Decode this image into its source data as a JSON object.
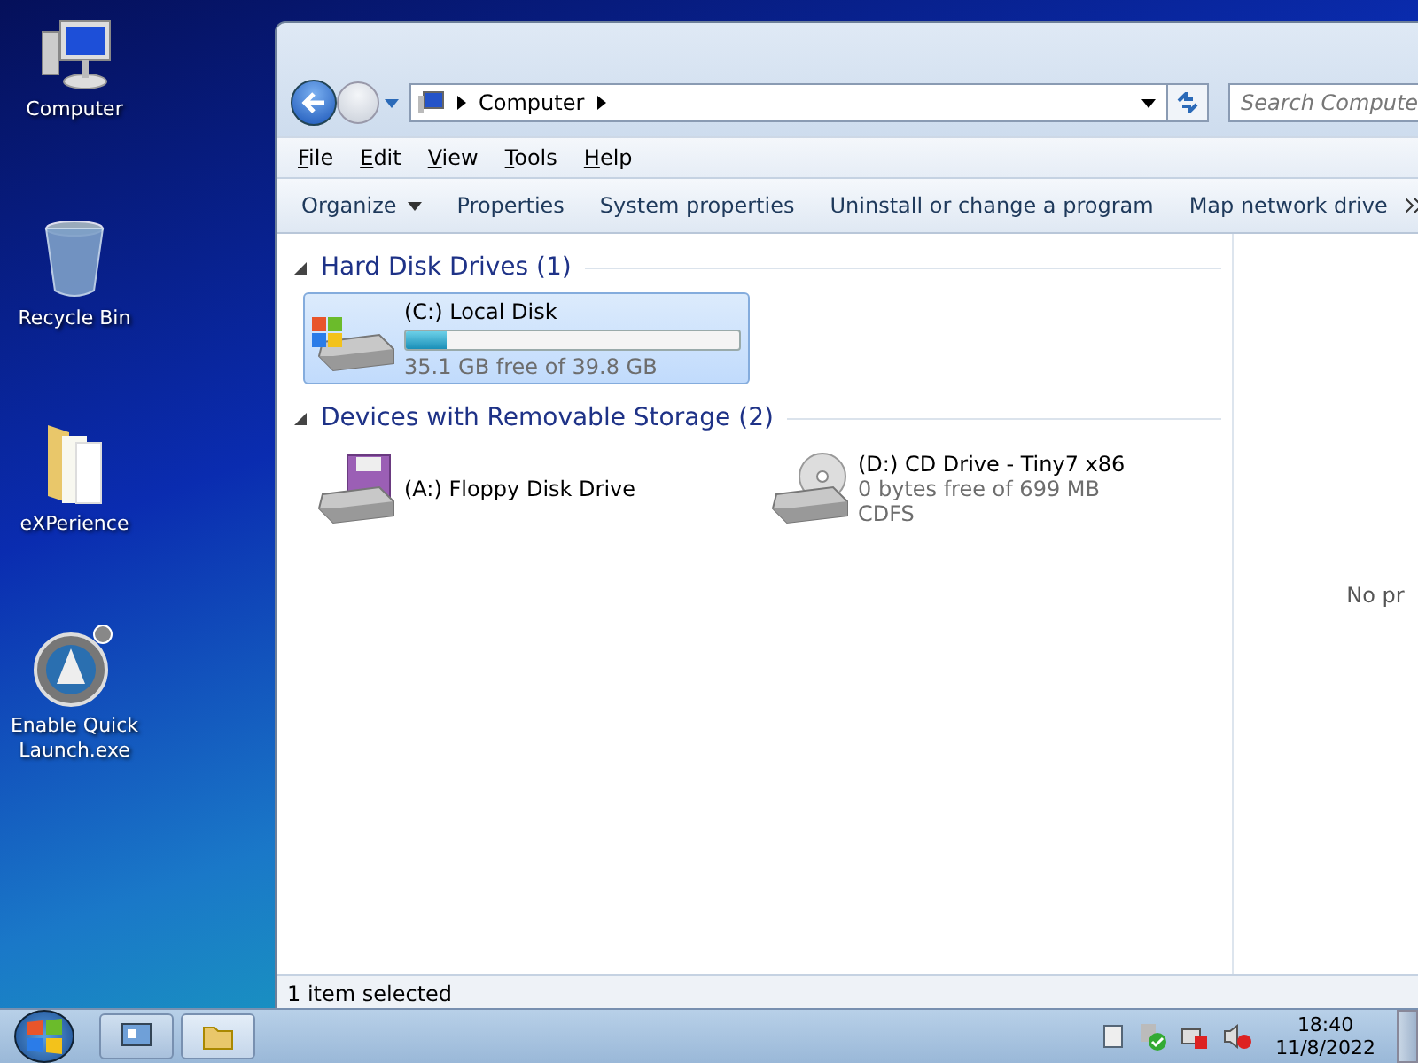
{
  "desktop_icons": [
    {
      "kind": "computer",
      "label": "Computer"
    },
    {
      "kind": "bin",
      "label": "Recycle Bin"
    },
    {
      "kind": "folder",
      "label": "eXPerience"
    },
    {
      "kind": "app",
      "label": "Enable Quick Launch.exe"
    }
  ],
  "window": {
    "breadcrumb": [
      "Computer"
    ],
    "search": {
      "placeholder": "Search Compute"
    },
    "menu": [
      "File",
      "Edit",
      "View",
      "Tools",
      "Help"
    ],
    "commands": [
      {
        "label": "Organize",
        "dropdown": true
      },
      {
        "label": "Properties",
        "dropdown": false
      },
      {
        "label": "System properties",
        "dropdown": false
      },
      {
        "label": "Uninstall or change a program",
        "dropdown": false
      },
      {
        "label": "Map network drive",
        "dropdown": false
      }
    ],
    "groups": [
      {
        "title": "Hard Disk Drives (1)",
        "expanded": true,
        "items": [
          {
            "kind": "hdd",
            "name": "(C:) Local Disk",
            "level": 0.12,
            "details": [
              "35.1 GB free of 39.8 GB"
            ],
            "selected": true
          }
        ]
      },
      {
        "title": "Devices with Removable Storage (2)",
        "expanded": true,
        "items": [
          {
            "kind": "floppy",
            "name": "(A:) Floppy Disk Drive",
            "selected": false
          },
          {
            "kind": "cd",
            "name": "(D:) CD Drive - Tiny7 x86",
            "details": [
              "0 bytes free of 699 MB",
              "CDFS"
            ],
            "selected": false
          }
        ]
      }
    ],
    "preview": "No pr",
    "status": "1 item selected"
  },
  "taskbar": {
    "time": "18:40",
    "date": "11/8/2022"
  }
}
